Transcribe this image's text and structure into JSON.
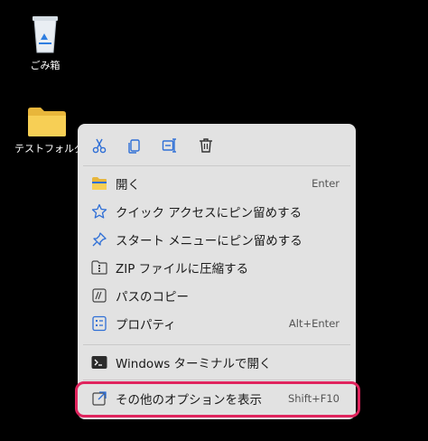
{
  "desktop": {
    "recycle_bin_label": "ごみ箱",
    "folder_label": "テストフォルダー"
  },
  "context_menu": {
    "toolbar_icons": [
      "scissors-icon",
      "copy-icon",
      "rename-icon",
      "trash-icon"
    ],
    "items": [
      {
        "label": "開く",
        "shortcut": "Enter",
        "icon": "folder-icon"
      },
      {
        "label": "クイック アクセスにピン留めする",
        "shortcut": "",
        "icon": "star-icon"
      },
      {
        "label": "スタート メニューにピン留めする",
        "shortcut": "",
        "icon": "pin-icon"
      },
      {
        "label": "ZIP ファイルに圧縮する",
        "shortcut": "",
        "icon": "zip-icon"
      },
      {
        "label": "パスのコピー",
        "shortcut": "",
        "icon": "copy-path-icon"
      },
      {
        "label": "プロパティ",
        "shortcut": "Alt+Enter",
        "icon": "properties-icon"
      },
      {
        "label": "Windows ターミナルで開く",
        "shortcut": "",
        "icon": "terminal-icon"
      },
      {
        "label": "その他のオプションを表示",
        "shortcut": "Shift+F10",
        "icon": "more-options-icon"
      }
    ]
  },
  "colors": {
    "menu_bg": "#e2e2e2",
    "highlight_border": "#e0245e",
    "accent_blue": "#2f6fd6"
  }
}
